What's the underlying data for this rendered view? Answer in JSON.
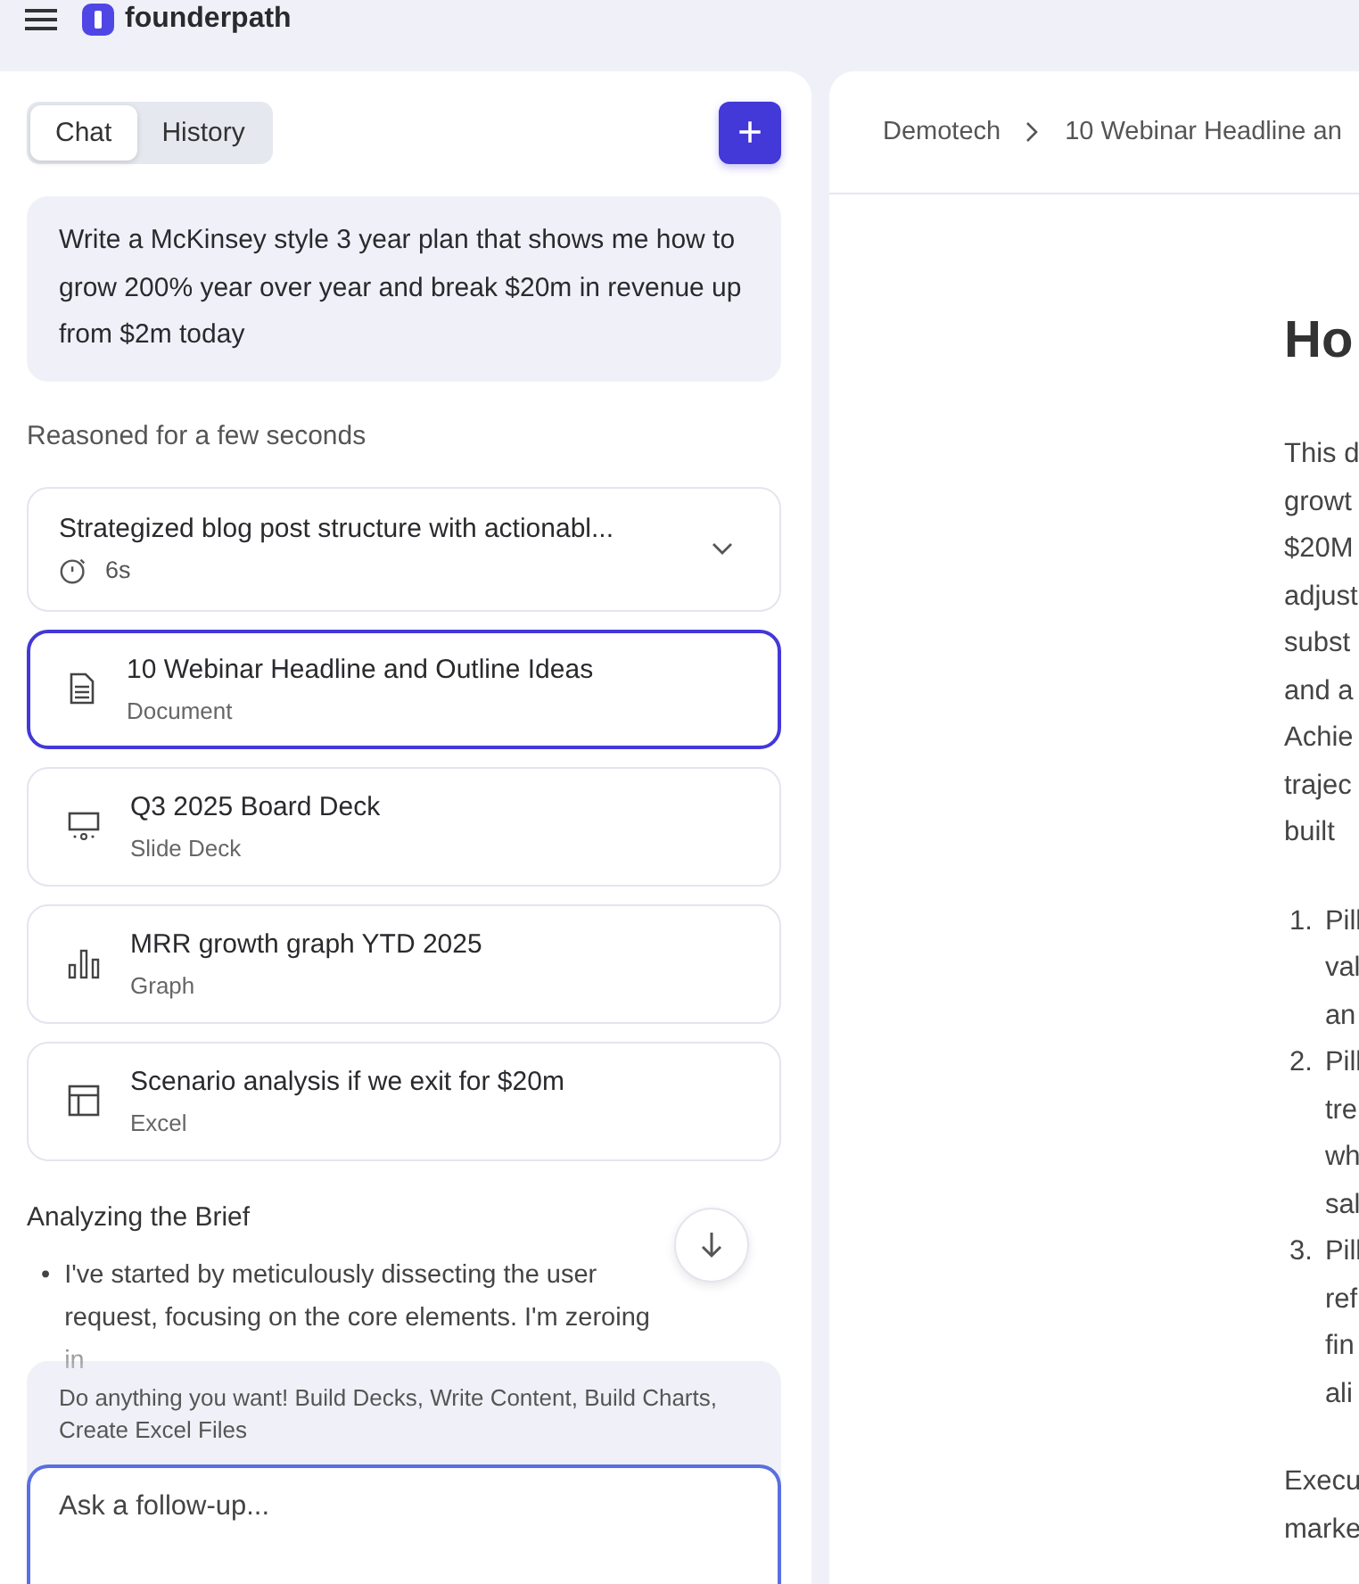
{
  "header": {
    "brand": "founderpath"
  },
  "tabs": [
    {
      "label": "Chat",
      "selected": true
    },
    {
      "label": "History",
      "selected": false
    }
  ],
  "new_button": {
    "label": "+"
  },
  "prompt": "Write a McKinsey style 3 year plan that shows me how to grow 200% year over year and break $20m in revenue up from $2m today",
  "reasoned_label": "Reasoned for a few seconds",
  "reasoning": {
    "title": "Strategized blog post structure with actionabl...",
    "duration": "6s",
    "expanded": false
  },
  "artifacts": [
    {
      "title": "10 Webinar Headline and Outline Ideas",
      "type_label": "Document",
      "kind": "document",
      "selected": true
    },
    {
      "title": "Q3 2025 Board Deck",
      "type_label": "Slide Deck",
      "kind": "slides",
      "selected": false
    },
    {
      "title": "MRR growth graph YTD 2025",
      "type_label": "Graph",
      "kind": "graph",
      "selected": false
    },
    {
      "title": "Scenario analysis if we exit for $20m",
      "type_label": "Excel",
      "kind": "table",
      "selected": false
    }
  ],
  "section_title": "Analyzing the Brief",
  "bullets": [
    {
      "marker": "•",
      "text": "I've started by meticulously dissecting the user request, focusing on the core elements. I'm zeroing in"
    }
  ],
  "composer": {
    "hint": "Do anything you want! Build Decks, Write Content, Build Charts, Create Excel Files",
    "placeholder": "Ask a follow-up..."
  },
  "breadcrumb": [
    "Demotech",
    "10 Webinar Headline an"
  ],
  "document": {
    "heading": "Ho",
    "intro_lines": [
      "This d",
      "growt",
      "$20M",
      "adjust",
      "subst",
      "and a",
      "Achie",
      "trajec",
      "built"
    ],
    "list": [
      {
        "number": "1.",
        "lines": [
          "Pill",
          "val",
          "an"
        ]
      },
      {
        "number": "2.",
        "lines": [
          "Pill",
          "tre",
          "wh",
          "sal"
        ]
      },
      {
        "number": "3.",
        "lines": [
          "Pill",
          "ref",
          "fin",
          "ali"
        ]
      }
    ],
    "outro_lines": [
      "Execu",
      "marke"
    ]
  }
}
